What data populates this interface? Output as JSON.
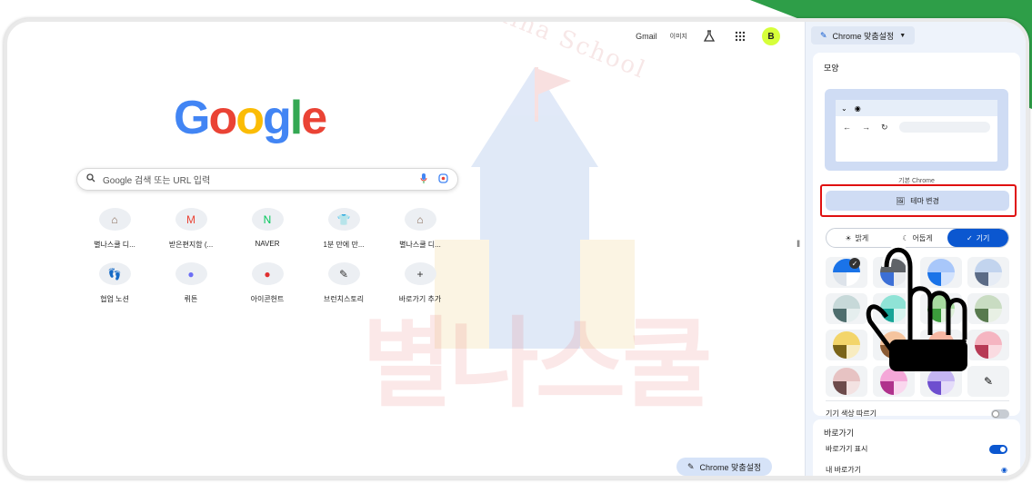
{
  "watermark": {
    "school_text": "Byulna School",
    "big_text": "별나스쿨"
  },
  "topbar": {
    "gmail": "Gmail",
    "images": "이미지",
    "avatar": "B"
  },
  "google": {
    "letters": [
      {
        "ch": "G",
        "color": "#4285F4"
      },
      {
        "ch": "o",
        "color": "#EA4335"
      },
      {
        "ch": "o",
        "color": "#FBBC05"
      },
      {
        "ch": "g",
        "color": "#4285F4"
      },
      {
        "ch": "l",
        "color": "#34A853"
      },
      {
        "ch": "e",
        "color": "#EA4335"
      }
    ]
  },
  "search": {
    "placeholder": "Google 검색 또는 URL 입력"
  },
  "shortcuts": [
    {
      "label": "별나스쿨 디...",
      "icon": "school-icon",
      "glyph": "⌂",
      "color": "#8a6d5a"
    },
    {
      "label": "받은편지함 (...",
      "icon": "gmail-icon",
      "glyph": "M",
      "color": "#EA4335"
    },
    {
      "label": "NAVER",
      "icon": "naver-icon",
      "glyph": "N",
      "color": "#03C75A"
    },
    {
      "label": "1분 만에 만...",
      "icon": "shirt-icon",
      "glyph": "👕",
      "color": "#555"
    },
    {
      "label": "별나스쿨 디...",
      "icon": "school-icon",
      "glyph": "⌂",
      "color": "#8a6d5a"
    },
    {
      "label": "협업 노션",
      "icon": "footprint-icon",
      "glyph": "👣",
      "color": "#7a3b1d"
    },
    {
      "label": "뤼튼",
      "icon": "wrtn-icon",
      "glyph": "●",
      "color": "#6c6ef5"
    },
    {
      "label": "아이콘헌트",
      "icon": "iconhunt-icon",
      "glyph": "●",
      "color": "#e03030"
    },
    {
      "label": "브런치스토리",
      "icon": "brunch-icon",
      "glyph": "✎",
      "color": "#333"
    },
    {
      "label": "바로가기 추가",
      "icon": "plus-icon",
      "glyph": "+",
      "color": "#333"
    }
  ],
  "bottom_button": {
    "label": "Chrome 맞춤설정"
  },
  "panel": {
    "select_label": "Chrome 맞춤설정",
    "appearance_title": "모양",
    "preview_caption": "기본 Chrome",
    "theme_button": "테마 변경",
    "modes": [
      {
        "label": "밝게",
        "icon": "sun-icon",
        "glyph": "☀",
        "selected": false
      },
      {
        "label": "어둡게",
        "icon": "moon-icon",
        "glyph": "☾",
        "selected": false
      },
      {
        "label": "기기",
        "icon": "check-icon",
        "glyph": "✓",
        "selected": true
      }
    ],
    "swatches": [
      {
        "top": "#1a73e8",
        "bl": "#dde3ea",
        "br": "#fff",
        "checked": true
      },
      {
        "top": "#5f6368",
        "bl": "#3c6fd6",
        "br": "#e8eaed",
        "checked": false
      },
      {
        "top": "#a8c7fa",
        "bl": "#1a73e8",
        "br": "#d3e3fd",
        "checked": false
      },
      {
        "top": "#c2d4ee",
        "bl": "#5b6b86",
        "br": "#e6ecf5",
        "checked": false
      },
      {
        "top": "#c7d9d9",
        "bl": "#4f6e6e",
        "br": "#e5eeee",
        "checked": false
      },
      {
        "top": "#8fe3d6",
        "bl": "#16a597",
        "br": "#d8f5f0",
        "checked": false
      },
      {
        "top": "#a8dba0",
        "bl": "#3c9c3c",
        "br": "#dff1db",
        "checked": false
      },
      {
        "top": "#c9dcc2",
        "bl": "#587a4e",
        "br": "#e8f0e4",
        "checked": false
      },
      {
        "top": "#f3d56a",
        "bl": "#7a6418",
        "br": "#f8ecc0",
        "checked": false
      },
      {
        "top": "#f5c49e",
        "bl": "#8a5a33",
        "br": "#f9e3d1",
        "checked": false
      },
      {
        "top": "#f7b7a3",
        "bl": "#c25339",
        "br": "#fbdcd2",
        "checked": false
      },
      {
        "top": "#f5b5c1",
        "bl": "#b73a55",
        "br": "#fadbe1",
        "checked": false
      },
      {
        "top": "#e7c3c3",
        "bl": "#6d4b4b",
        "br": "#f3e2e2",
        "checked": false
      },
      {
        "top": "#f4a7d8",
        "bl": "#b0328c",
        "br": "#fad7ee",
        "checked": false
      },
      {
        "top": "#c4b5f2",
        "bl": "#6e4fcf",
        "br": "#e4dcf9",
        "checked": false
      },
      {
        "custom": true,
        "checked": false
      }
    ],
    "follow_device_color": "기기 색상 따르기",
    "shortcuts_title": "바로가기",
    "show_shortcuts": "바로가기 표시",
    "my_shortcuts": "내 바로가기"
  },
  "colors": {
    "accent": "#0b57d0",
    "highlight_box": "#e01010",
    "corner": "#2e9e48"
  }
}
